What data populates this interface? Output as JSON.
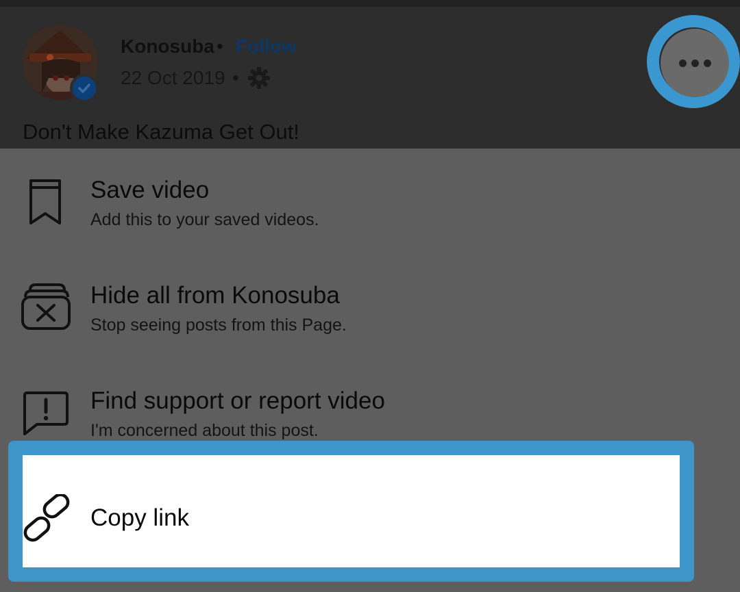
{
  "post": {
    "page_name": "Konosuba",
    "separator": "•",
    "follow_label": "Follow",
    "date": "22 Oct 2019",
    "caption": "Don't Make Kazuma Get Out!",
    "more_icon": "more-horizontal-icon",
    "privacy_icon": "gear-icon",
    "verified_icon": "checkmark-icon"
  },
  "menu": {
    "items": [
      {
        "title": "Save video",
        "subtitle": "Add this to your saved videos.",
        "icon": "bookmark-icon"
      },
      {
        "title": "Hide all from Konosuba",
        "subtitle": "Stop seeing posts from this Page.",
        "icon": "hide-stack-icon"
      },
      {
        "title": "Find support or report video",
        "subtitle": "I'm concerned about this post.",
        "icon": "report-icon"
      },
      {
        "title": "Copy link",
        "subtitle": "",
        "icon": "link-icon"
      }
    ]
  },
  "colors": {
    "highlight": "#3d95c9",
    "overlay": "#5e5e5e",
    "header": "#2d2d2d",
    "follow": "#0e3766"
  }
}
